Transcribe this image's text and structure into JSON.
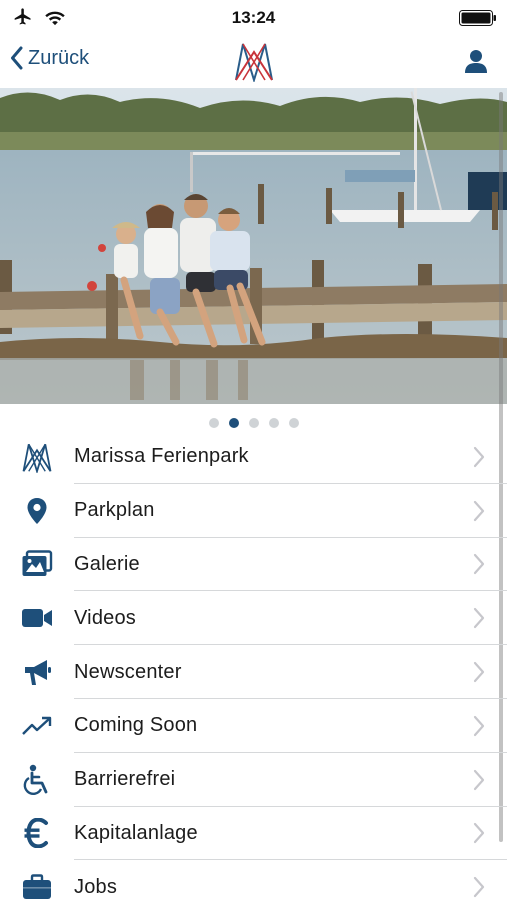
{
  "status_bar": {
    "time": "13:24",
    "icons": [
      "airplane-icon",
      "wifi-icon",
      "battery-icon"
    ]
  },
  "nav": {
    "back_label": "Zurück",
    "logo_icon": "marissa-logo-icon",
    "profile_icon": "user-icon"
  },
  "carousel": {
    "page_count": 5,
    "active_page": 2
  },
  "menu": {
    "items": [
      {
        "label": "Marissa Ferienpark",
        "icon": "marissa-logo-icon"
      },
      {
        "label": "Parkplan",
        "icon": "map-pin-icon"
      },
      {
        "label": "Galerie",
        "icon": "gallery-icon"
      },
      {
        "label": "Videos",
        "icon": "video-camera-icon"
      },
      {
        "label": "Newscenter",
        "icon": "megaphone-icon"
      },
      {
        "label": "Coming Soon",
        "icon": "trend-up-icon"
      },
      {
        "label": "Barrierefrei",
        "icon": "wheelchair-icon"
      },
      {
        "label": "Kapitalanlage",
        "icon": "euro-icon"
      },
      {
        "label": "Jobs",
        "icon": "briefcase-icon"
      }
    ]
  },
  "colors": {
    "accent": "#1e4f7a",
    "logo_red": "#c8343a",
    "logo_blue": "#2a5d8a",
    "separator": "#d6d8da",
    "chevron": "#c7c7cc"
  }
}
